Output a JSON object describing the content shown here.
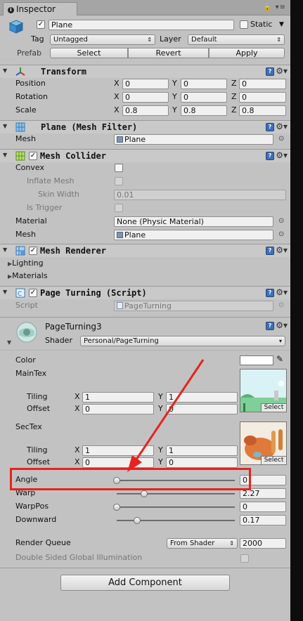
{
  "tab": {
    "title": "Inspector"
  },
  "gameobject": {
    "name": "Plane",
    "static_label": "Static",
    "tag_label": "Tag",
    "tag_value": "Untagged",
    "layer_label": "Layer",
    "layer_value": "Default",
    "prefab_label": "Prefab",
    "select": "Select",
    "revert": "Revert",
    "apply": "Apply"
  },
  "transform": {
    "title": "Transform",
    "position_label": "Position",
    "rotation_label": "Rotation",
    "scale_label": "Scale",
    "position": [
      "0",
      "0",
      "0"
    ],
    "rotation": [
      "0",
      "0",
      "0"
    ],
    "scale": [
      "0.8",
      "0.8",
      "0.8"
    ]
  },
  "axes": {
    "x": "X",
    "y": "Y",
    "z": "Z"
  },
  "mesh_filter": {
    "title": "Plane (Mesh Filter)",
    "mesh_label": "Mesh",
    "mesh_value": "Plane"
  },
  "mesh_collider": {
    "title": "Mesh Collider",
    "convex": "Convex",
    "inflate": "Inflate Mesh",
    "skin_width": "Skin Width",
    "skin_width_value": "0.01",
    "is_trigger": "Is Trigger",
    "material_label": "Material",
    "material_value": "None (Physic Material)",
    "mesh_label": "Mesh",
    "mesh_value": "Plane"
  },
  "mesh_renderer": {
    "title": "Mesh Renderer",
    "lighting": "Lighting",
    "materials": "Materials"
  },
  "script": {
    "title": "Page Turning (Script)",
    "label": "Script",
    "value": "PageTurning"
  },
  "material": {
    "name": "PageTurning3",
    "shader_label": "Shader",
    "shader_value": "Personal/PageTurning",
    "color": "Color",
    "maintex": "MainTex",
    "sectex": "SecTex",
    "tiling": "Tiling",
    "offset": "Offset",
    "maintex_tiling": [
      "1",
      "1"
    ],
    "maintex_offset": [
      "0",
      "0"
    ],
    "sectex_tiling": [
      "1",
      "1"
    ],
    "sectex_offset": [
      "0",
      "0"
    ],
    "select": "Select",
    "angle_label": "Angle",
    "angle_value": "0",
    "angle_fraction": 0.0,
    "warp_label": "Warp",
    "warp_value": "2.27",
    "warp_fraction": 0.23,
    "warppos_label": "WarpPos",
    "warppos_value": "0",
    "warppos_fraction": 0.0,
    "downward_label": "Downward",
    "downward_value": "0.17",
    "downward_fraction": 0.17,
    "render_queue_label": "Render Queue",
    "render_queue_mode": "From Shader",
    "render_queue_value": "2000",
    "dsgi_label": "Double Sided Global Illumination"
  },
  "add_component": "Add Component",
  "colors": {
    "highlight": "#e8221f",
    "arrow": "#e8221f",
    "panel": "#c2c2c2"
  }
}
